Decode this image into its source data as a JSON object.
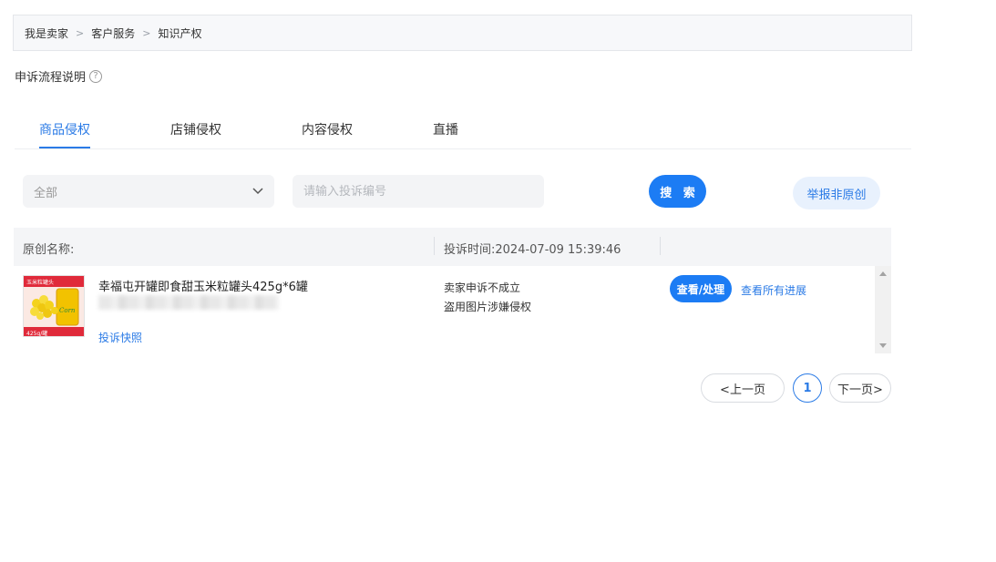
{
  "breadcrumb": [
    "我是卖家",
    "客户服务",
    "知识产权"
  ],
  "breadcrumb_sep": ">",
  "flow_title": "申诉流程说明",
  "help_glyph": "?",
  "tabs": [
    {
      "label": "商品侵权",
      "active": true
    },
    {
      "label": "店铺侵权",
      "active": false
    },
    {
      "label": "内容侵权",
      "active": false
    },
    {
      "label": "直播",
      "active": false
    }
  ],
  "filters": {
    "select_value": "全部",
    "search_placeholder": "请输入投诉编号",
    "search_button": "搜 索",
    "report_button": "举报非原创"
  },
  "table": {
    "col_original": "原创名称:",
    "col_time": "投诉时间:2024-07-09 15:39:46",
    "rows": [
      {
        "product_name": "幸福屯开罐即食甜玉米粒罐头425g*6罐",
        "thumb_brand": "玉米粒罐头",
        "thumb_weight": "425g/罐",
        "thumb_label": "Corn",
        "snapshot_link": "投诉快照",
        "status_line1": "卖家申诉不成立",
        "status_line2": "盗用图片涉嫌侵权",
        "view_button": "查看/处理",
        "progress_link": "查看所有进展"
      }
    ]
  },
  "pagination": {
    "prev": "<上一页",
    "current": "1",
    "next": "下一页>"
  },
  "colors": {
    "accent": "#1c7cf4",
    "link": "#2b7be6",
    "light_accent_bg": "#e8f1fd"
  }
}
